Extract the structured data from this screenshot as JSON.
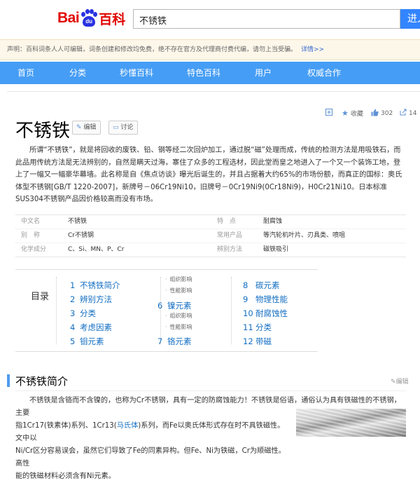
{
  "header": {
    "logo_bai": "Bai",
    "logo_du": "du",
    "logo_baike": "百科",
    "search_value": "不锈铁",
    "search_button": "进入"
  },
  "notice": {
    "text": "声明：百科词条人人可编辑，词条创建和修改均免费，绝不存在官方及代理商付费代编，请勿上当受骗。",
    "more": "详情>>"
  },
  "nav": [
    "首页",
    "分类",
    "秒懂百科",
    "特色百科",
    "用户",
    "权威合作"
  ],
  "toolbar": {
    "collect": "收藏",
    "likes": "302",
    "shares": "14"
  },
  "entry": {
    "title": "不锈铁",
    "edit": "编辑",
    "discuss": "讨论",
    "intro": "所谓“不锈铁”，就是将回收的废铁、铅、钢等经二次回炉加工，通过脱“磁”处理而成，传统的检测方法是用吸铁石，而此品用传统方法是无法辨别的，自然是瞒天过海，寨住了众多的工程选材，因此堂而皇之地进入了一个又一个装饰工地，登上了一幅又一幅豪华幕墙。此名称是自《焦点访谈》曝光后诞生的，并且占据着大约65%的市场份额，而真正的国标：奥氏体型不锈钢[GB/T 1220-2007]，新牌号－06Cr19Ni10，旧牌号－0Cr19Ni9(0Cr18Ni9)，H0Cr21Ni10。日本标准SUS304不锈钢产品因价格较高而没有市场。"
  },
  "basic_info": [
    {
      "k1": "中文名",
      "v1": "不锈铁",
      "k2": "特　点",
      "v2": "耐腐蚀"
    },
    {
      "k1": "别　称",
      "v1": "Cr不锈钢",
      "k2": "常用产品",
      "v2": "等汽轮机叶片、刃具类、喷咀"
    },
    {
      "k1": "化学成分",
      "v1": "C、Si、MN、P、Cr",
      "k2": "辨别方法",
      "v2": "磁铁吸引"
    }
  ],
  "toc": {
    "label": "目录",
    "col1": [
      {
        "n": "1",
        "t": "不锈铁简介"
      },
      {
        "n": "2",
        "t": "辨别方法"
      },
      {
        "n": "3",
        "t": "分类"
      },
      {
        "n": "4",
        "t": "考虑因素"
      },
      {
        "n": "5",
        "t": "钼元素"
      }
    ],
    "col2_subs_top": [
      "组织影响",
      "性能影响"
    ],
    "col2_item6": {
      "n": "6",
      "t": "镍元素"
    },
    "col2_subs_bottom": [
      "组织影响",
      "性能影响"
    ],
    "col2_item7": {
      "n": "7",
      "t": "铬元素"
    },
    "col3": [
      {
        "n": "8",
        "t": "碳元素"
      },
      {
        "n": "9",
        "t": "物理性能"
      },
      {
        "n": "10",
        "t": "耐腐蚀性"
      },
      {
        "n": "11",
        "t": "分类"
      },
      {
        "n": "12",
        "t": "带磁"
      }
    ]
  },
  "section": {
    "title": "不锈铁简介",
    "edit": "编辑",
    "line1": "不锈铁是含铬而不含镍的，也称为Cr不锈钢，具有一定的防腐蚀能力！不锈铁是俗语，通俗认为具有铁磁性的不锈钢，主要",
    "line2_pre": "指1Cr17(铁素体)系列、1Cr13(",
    "line2_link": "马氏体",
    "line2_post": ")系列，而Fe以奥氏体形式存在时不具铁磁性。文中以",
    "line3": "Ni/Cr区分容易误会，虽然它们导致了Fe的同素异构。但Fe、Ni为铁磁，Cr为顺磁性。高性",
    "line4": "能的铁磁材料必须含有Ni元素。"
  }
}
